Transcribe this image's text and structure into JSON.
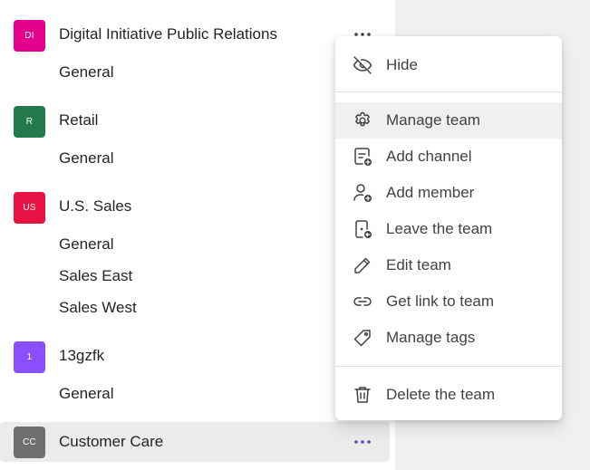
{
  "teams": [
    {
      "initials": "DI",
      "name": "Digital Initiative Public Relations",
      "color": "#e3008c",
      "channels": [
        "General"
      ]
    },
    {
      "initials": "R",
      "name": "Retail",
      "color": "#237b4b",
      "channels": [
        "General"
      ]
    },
    {
      "initials": "US",
      "name": "U.S. Sales",
      "color": "#e81144",
      "channels": [
        "General",
        "Sales East",
        "Sales West"
      ]
    },
    {
      "initials": "1",
      "name": "13gzfk",
      "color": "#8a4fff",
      "channels": [
        "General"
      ]
    },
    {
      "initials": "CC",
      "name": "Customer Care",
      "color": "#6e6e6e",
      "channels": []
    }
  ],
  "more_options_icon": "more-horizontal-icon",
  "menu": {
    "hide": {
      "label": "Hide",
      "icon": "eye-off-icon"
    },
    "items": [
      {
        "label": "Manage team",
        "icon": "gear-icon"
      },
      {
        "label": "Add channel",
        "icon": "add-channel-icon"
      },
      {
        "label": "Add member",
        "icon": "add-person-icon"
      },
      {
        "label": "Leave the team",
        "icon": "leave-icon"
      },
      {
        "label": "Edit team",
        "icon": "pencil-icon"
      },
      {
        "label": "Get link to team",
        "icon": "link-icon"
      },
      {
        "label": "Manage tags",
        "icon": "tag-icon"
      }
    ],
    "delete": {
      "label": "Delete the team",
      "icon": "trash-icon"
    }
  },
  "colors": {
    "accent": "#4f52b2",
    "menu_hover": "#f0f0f0",
    "selected_row": "#edebe9"
  }
}
